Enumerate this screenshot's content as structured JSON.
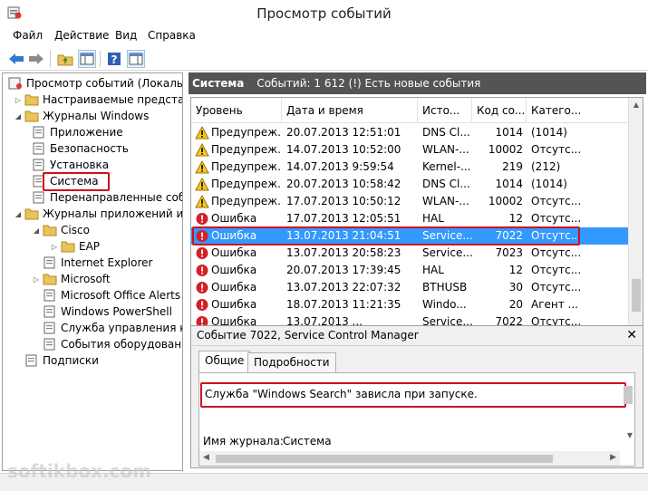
{
  "window": {
    "title": "Просмотр событий"
  },
  "menu": [
    "Файл",
    "Действие",
    "Вид",
    "Справка"
  ],
  "toolbar": {
    "icons": [
      "back-icon",
      "forward-icon",
      "folder-up-icon",
      "show-hide-tree-icon",
      "help-icon",
      "properties-icon"
    ]
  },
  "tree": {
    "root": "Просмотр событий (Локальный)",
    "custom_views": "Настраиваемые представления",
    "windows_logs": "Журналы Windows",
    "application": "Приложение",
    "security": "Безопасность",
    "setup": "Установка",
    "system": "Система",
    "forwarded": "Перенаправленные события",
    "app_services_logs": "Журналы приложений и служб",
    "cisco": "Cisco",
    "eap": "EAP",
    "ie": "Internet Explorer",
    "microsoft": "Microsoft",
    "ms_office_alerts": "Microsoft Office Alerts",
    "powershell": "Windows PowerShell",
    "key_mgmt": "Служба управления ключами",
    "hardware_events": "События оборудования",
    "subscriptions": "Подписки"
  },
  "panel": {
    "log_name": "Система",
    "summary": "Событий: 1 612 (!) Есть новые события"
  },
  "grid": {
    "columns": [
      "Уровень",
      "Дата и время",
      "Источник",
      "Код события",
      "Категория"
    ],
    "column_labels_visible": [
      "Уровень",
      "Дата и время",
      "Исто...",
      "Код со...",
      "Катего..."
    ],
    "rows": [
      {
        "level": "Предупреж...",
        "type": "warning",
        "date": "20.07.2013 12:51:01",
        "source": "DNS Cl...",
        "code": "1014",
        "category": "(1014)"
      },
      {
        "level": "Предупреж...",
        "type": "warning",
        "date": "14.07.2013 10:52:00",
        "source": "WLAN-...",
        "code": "10002",
        "category": "Отсутс..."
      },
      {
        "level": "Предупреж...",
        "type": "warning",
        "date": "14.07.2013 9:59:54",
        "source": "Kernel-...",
        "code": "219",
        "category": "(212)"
      },
      {
        "level": "Предупреж...",
        "type": "warning",
        "date": "20.07.2013 10:58:42",
        "source": "DNS Cl...",
        "code": "1014",
        "category": "(1014)"
      },
      {
        "level": "Предупреж...",
        "type": "warning",
        "date": "17.07.2013 10:50:12",
        "source": "WLAN-...",
        "code": "10002",
        "category": "Отсутс..."
      },
      {
        "level": "Ошибка",
        "type": "error",
        "date": "17.07.2013 12:05:51",
        "source": "HAL",
        "code": "12",
        "category": "Отсутс..."
      },
      {
        "level": "Ошибка",
        "type": "error",
        "date": "13.07.2013 21:04:51",
        "source": "Service...",
        "code": "7022",
        "category": "Отсутс...",
        "selected": true
      },
      {
        "level": "Ошибка",
        "type": "error",
        "date": "13.07.2013 20:58:23",
        "source": "Service...",
        "code": "7023",
        "category": "Отсутс..."
      },
      {
        "level": "Ошибка",
        "type": "error",
        "date": "20.07.2013 17:39:45",
        "source": "HAL",
        "code": "12",
        "category": "Отсутс..."
      },
      {
        "level": "Ошибка",
        "type": "error",
        "date": "13.07.2013 22:07:32",
        "source": "BTHUSB",
        "code": "30",
        "category": "Отсутс..."
      },
      {
        "level": "Ошибка",
        "type": "error",
        "date": "18.07.2013 11:21:35",
        "source": "Windo...",
        "code": "20",
        "category": "Агент ..."
      },
      {
        "level": "Ошибка",
        "type": "error",
        "date": "13.07.2013 ...",
        "source": "Service...",
        "code": "7022",
        "category": "Отсутс..."
      }
    ]
  },
  "details": {
    "title": "Событие 7022, Service Control Manager",
    "tabs": [
      "Общие",
      "Подробности"
    ],
    "message": "Служба \"Windows Search\" зависла при запуске.",
    "log_name_label": "Имя журнала:",
    "log_name_value": "Система"
  },
  "watermark": "softikbox.com",
  "colors": {
    "header_bg": "#545454",
    "selection": "#3399ff",
    "highlight": "#d0101e"
  }
}
